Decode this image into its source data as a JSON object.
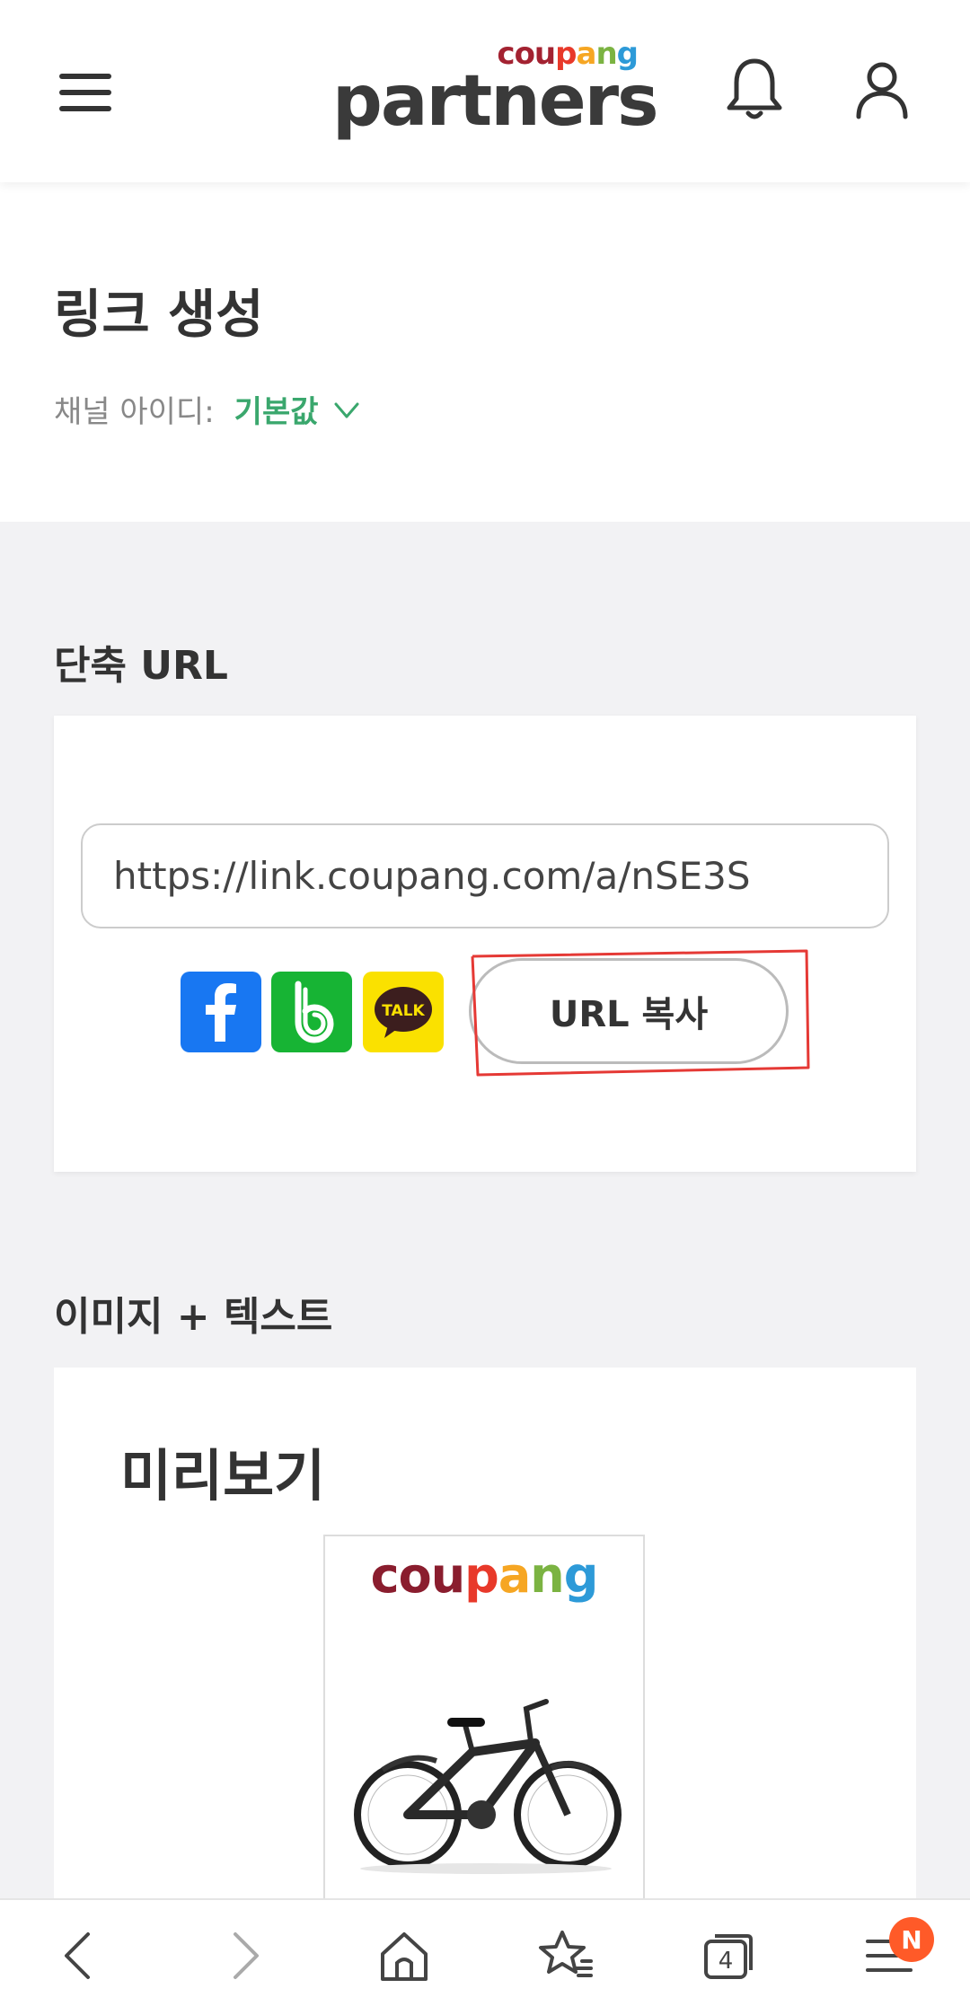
{
  "header": {
    "logo_small": "coupang",
    "logo_main": "partners"
  },
  "page": {
    "title": "링크 생성",
    "channel_label": "채널 아이디:",
    "channel_value": "기본값"
  },
  "short_url": {
    "section_title": "단축 URL",
    "url_value": "https://link.coupang.com/a/nSE3S",
    "share_icons": [
      "facebook-icon",
      "band-icon",
      "kakaotalk-icon"
    ],
    "talk_label": "TALK",
    "copy_button": "URL 복사"
  },
  "image_text": {
    "section_title": "이미지 + 텍스트",
    "preview_title": "미리보기",
    "product_logo": "coupang"
  },
  "bottom_nav": {
    "items": [
      "back-icon",
      "forward-icon",
      "home-icon",
      "bookmarks-icon",
      "tabs-icon",
      "menu-icon"
    ],
    "tab_count": "4",
    "menu_badge": "N"
  },
  "colors": {
    "channel_green": "#3aa76d",
    "facebook": "#1877f2",
    "band": "#17b434",
    "kakao": "#fae100",
    "highlight_red": "#e53935",
    "badge_orange": "#ff5a28"
  }
}
